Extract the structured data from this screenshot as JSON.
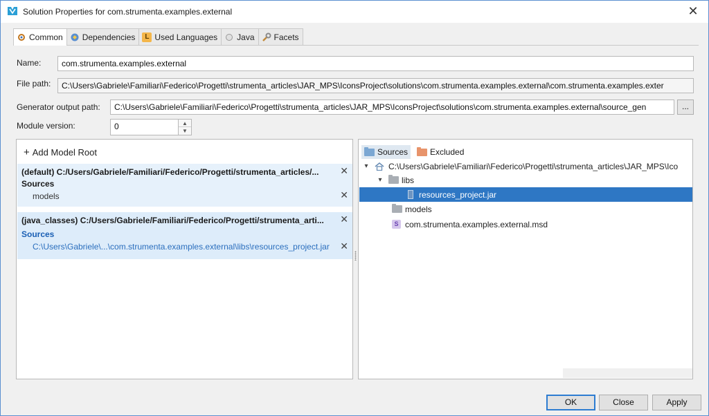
{
  "window": {
    "title": "Solution Properties for com.strumenta.examples.external",
    "close": "✕"
  },
  "tabs": [
    {
      "label": "Common",
      "active": true
    },
    {
      "label": "Dependencies",
      "active": false
    },
    {
      "label": "Used Languages",
      "active": false
    },
    {
      "label": "Java",
      "active": false
    },
    {
      "label": "Facets",
      "active": false
    }
  ],
  "form": {
    "name_label": "Name:",
    "name_value": "com.strumenta.examples.external",
    "filepath_label": "File path:",
    "filepath_value": "C:\\Users\\Gabriele\\Familiari\\Federico\\Progetti\\strumenta_articles\\JAR_MPS\\IconsProject\\solutions\\com.strumenta.examples.external\\com.strumenta.examples.exter",
    "genpath_label": "Generator output path:",
    "genpath_value": "C:\\Users\\Gabriele\\Familiari\\Federico\\Progetti\\strumenta_articles\\JAR_MPS\\IconsProject\\solutions\\com.strumenta.examples.external\\source_gen",
    "browse_label": "...",
    "version_label": "Module version:",
    "version_value": "0"
  },
  "model_roots": {
    "add_label": "Add Model Root",
    "roots": [
      {
        "header": "(default) C:/Users/Gabriele/Familiari/Federico/Progetti/strumenta_articles/...",
        "sources_label": "Sources",
        "items": [
          "models"
        ]
      },
      {
        "header": "(java_classes) C:/Users/Gabriele/Familiari/Federico/Progetti/strumenta_arti...",
        "sources_label": "Sources",
        "items": [
          "C:\\Users\\Gabriele\\...\\com.strumenta.examples.external\\libs\\resources_project.jar"
        ]
      }
    ]
  },
  "tree": {
    "tab_sources": "Sources",
    "tab_excluded": "Excluded",
    "root": "C:\\Users\\Gabriele\\Familiari\\Federico\\Progetti\\strumenta_articles\\JAR_MPS\\Ico",
    "libs": "libs",
    "jar": "resources_project.jar",
    "models": "models",
    "msd": "com.strumenta.examples.external.msd",
    "s_letter": "S"
  },
  "buttons": {
    "ok": "OK",
    "close": "Close",
    "apply": "Apply"
  },
  "colors": {
    "selection": "#2e77c4",
    "accent_border": "#2d7cd1",
    "sources_blue": "#1a5fb4"
  }
}
